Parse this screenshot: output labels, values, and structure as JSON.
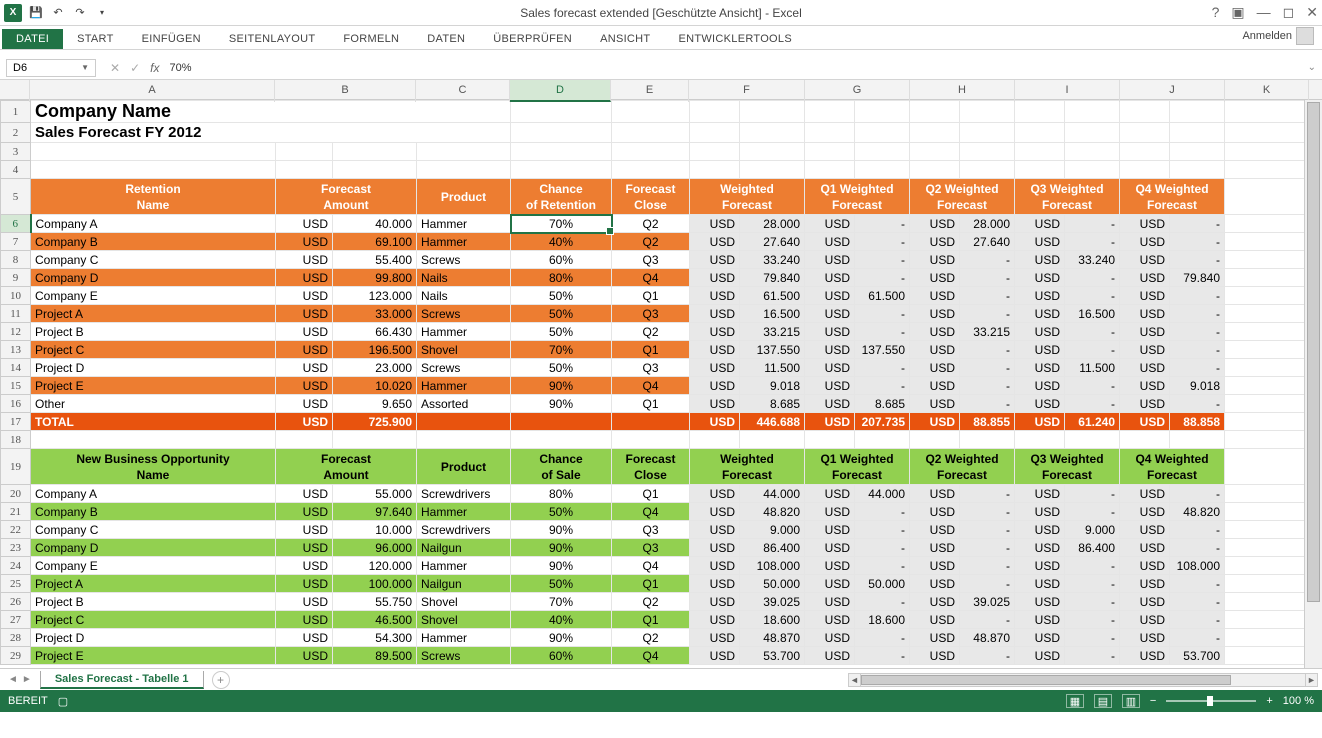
{
  "app": {
    "title": "Sales forecast extended  [Geschützte Ansicht] - Excel",
    "signin_label": "Anmelden"
  },
  "ribbon_tabs": [
    "DATEI",
    "START",
    "EINFÜGEN",
    "SEITENLAYOUT",
    "FORMELN",
    "DATEN",
    "ÜBERPRÜFEN",
    "ANSICHT",
    "ENTWICKLERTOOLS"
  ],
  "name_box": "D6",
  "formula": "70%",
  "columns": [
    "A",
    "B",
    "C",
    "D",
    "E",
    "F",
    "G",
    "H",
    "I",
    "J",
    "K"
  ],
  "selected_col": "D",
  "selected_row": 6,
  "title1": "Company Name",
  "title2": "Sales Forecast FY 2012",
  "headers_retention": {
    "name": "Retention\nName",
    "forecast_amount": "Forecast\nAmount",
    "product": "Product",
    "chance": "Chance\nof Retention",
    "close": "Forecast\nClose",
    "weighted": "Weighted\nForecast",
    "q1": "Q1 Weighted\nForecast",
    "q2": "Q2 Weighted\nForecast",
    "q3": "Q3 Weighted\nForecast",
    "q4": "Q4 Weighted\nForecast"
  },
  "headers_new": {
    "name": "New Business Opportunity\nName",
    "forecast_amount": "Forecast\nAmount",
    "product": "Product",
    "chance": "Chance\nof Sale",
    "close": "Forecast\nClose",
    "weighted": "Weighted\nForecast",
    "q1": "Q1 Weighted\nForecast",
    "q2": "Q2 Weighted\nForecast",
    "q3": "Q3 Weighted\nForecast",
    "q4": "Q4 Weighted\nForecast"
  },
  "currency": "USD",
  "dash": "-",
  "retention_rows": [
    {
      "name": "Company A",
      "amt": "40.000",
      "prod": "Hammer",
      "chance": "70%",
      "close": "Q2",
      "w": "28.000",
      "q1": "-",
      "q2": "28.000",
      "q3": "-",
      "q4": "-",
      "stripe": false
    },
    {
      "name": "Company B",
      "amt": "69.100",
      "prod": "Hammer",
      "chance": "40%",
      "close": "Q2",
      "w": "27.640",
      "q1": "-",
      "q2": "27.640",
      "q3": "-",
      "q4": "-",
      "stripe": true
    },
    {
      "name": "Company C",
      "amt": "55.400",
      "prod": "Screws",
      "chance": "60%",
      "close": "Q3",
      "w": "33.240",
      "q1": "-",
      "q2": "-",
      "q3": "33.240",
      "q4": "-",
      "stripe": false
    },
    {
      "name": "Company D",
      "amt": "99.800",
      "prod": "Nails",
      "chance": "80%",
      "close": "Q4",
      "w": "79.840",
      "q1": "-",
      "q2": "-",
      "q3": "-",
      "q4": "79.840",
      "stripe": true
    },
    {
      "name": "Company E",
      "amt": "123.000",
      "prod": "Nails",
      "chance": "50%",
      "close": "Q1",
      "w": "61.500",
      "q1": "61.500",
      "q2": "-",
      "q3": "-",
      "q4": "-",
      "stripe": false
    },
    {
      "name": "Project A",
      "amt": "33.000",
      "prod": "Screws",
      "chance": "50%",
      "close": "Q3",
      "w": "16.500",
      "q1": "-",
      "q2": "-",
      "q3": "16.500",
      "q4": "-",
      "stripe": true
    },
    {
      "name": "Project B",
      "amt": "66.430",
      "prod": "Hammer",
      "chance": "50%",
      "close": "Q2",
      "w": "33.215",
      "q1": "-",
      "q2": "33.215",
      "q3": "-",
      "q4": "-",
      "stripe": false
    },
    {
      "name": "Project C",
      "amt": "196.500",
      "prod": "Shovel",
      "chance": "70%",
      "close": "Q1",
      "w": "137.550",
      "q1": "137.550",
      "q2": "-",
      "q3": "-",
      "q4": "-",
      "stripe": true
    },
    {
      "name": "Project D",
      "amt": "23.000",
      "prod": "Screws",
      "chance": "50%",
      "close": "Q3",
      "w": "11.500",
      "q1": "-",
      "q2": "-",
      "q3": "11.500",
      "q4": "-",
      "stripe": false
    },
    {
      "name": "Project E",
      "amt": "10.020",
      "prod": "Hammer",
      "chance": "90%",
      "close": "Q4",
      "w": "9.018",
      "q1": "-",
      "q2": "-",
      "q3": "-",
      "q4": "9.018",
      "stripe": true
    },
    {
      "name": "Other",
      "amt": "9.650",
      "prod": "Assorted",
      "chance": "90%",
      "close": "Q1",
      "w": "8.685",
      "q1": "8.685",
      "q2": "-",
      "q3": "-",
      "q4": "-",
      "stripe": false
    }
  ],
  "retention_total": {
    "label": "TOTAL",
    "amt": "725.900",
    "w": "446.688",
    "q1": "207.735",
    "q2": "88.855",
    "q3": "61.240",
    "q4": "88.858"
  },
  "new_rows": [
    {
      "name": "Company A",
      "amt": "55.000",
      "prod": "Screwdrivers",
      "chance": "80%",
      "close": "Q1",
      "w": "44.000",
      "q1": "44.000",
      "q2": "-",
      "q3": "-",
      "q4": "-",
      "stripe": false
    },
    {
      "name": "Company B",
      "amt": "97.640",
      "prod": "Hammer",
      "chance": "50%",
      "close": "Q4",
      "w": "48.820",
      "q1": "-",
      "q2": "-",
      "q3": "-",
      "q4": "48.820",
      "stripe": true
    },
    {
      "name": "Company C",
      "amt": "10.000",
      "prod": "Screwdrivers",
      "chance": "90%",
      "close": "Q3",
      "w": "9.000",
      "q1": "-",
      "q2": "-",
      "q3": "9.000",
      "q4": "-",
      "stripe": false
    },
    {
      "name": "Company D",
      "amt": "96.000",
      "prod": "Nailgun",
      "chance": "90%",
      "close": "Q3",
      "w": "86.400",
      "q1": "-",
      "q2": "-",
      "q3": "86.400",
      "q4": "-",
      "stripe": true
    },
    {
      "name": "Company E",
      "amt": "120.000",
      "prod": "Hammer",
      "chance": "90%",
      "close": "Q4",
      "w": "108.000",
      "q1": "-",
      "q2": "-",
      "q3": "-",
      "q4": "108.000",
      "stripe": false
    },
    {
      "name": "Project A",
      "amt": "100.000",
      "prod": "Nailgun",
      "chance": "50%",
      "close": "Q1",
      "w": "50.000",
      "q1": "50.000",
      "q2": "-",
      "q3": "-",
      "q4": "-",
      "stripe": true
    },
    {
      "name": "Project B",
      "amt": "55.750",
      "prod": "Shovel",
      "chance": "70%",
      "close": "Q2",
      "w": "39.025",
      "q1": "-",
      "q2": "39.025",
      "q3": "-",
      "q4": "-",
      "stripe": false
    },
    {
      "name": "Project C",
      "amt": "46.500",
      "prod": "Shovel",
      "chance": "40%",
      "close": "Q1",
      "w": "18.600",
      "q1": "18.600",
      "q2": "-",
      "q3": "-",
      "q4": "-",
      "stripe": true
    },
    {
      "name": "Project D",
      "amt": "54.300",
      "prod": "Hammer",
      "chance": "90%",
      "close": "Q2",
      "w": "48.870",
      "q1": "-",
      "q2": "48.870",
      "q3": "-",
      "q4": "-",
      "stripe": false
    },
    {
      "name": "Project E",
      "amt": "89.500",
      "prod": "Screws",
      "chance": "60%",
      "close": "Q4",
      "w": "53.700",
      "q1": "-",
      "q2": "-",
      "q3": "-",
      "q4": "53.700",
      "stripe": true
    }
  ],
  "sheet_tab": "Sales Forecast - Tabelle 1",
  "status": {
    "ready": "BEREIT",
    "zoom": "100 %"
  },
  "chart_data": null
}
